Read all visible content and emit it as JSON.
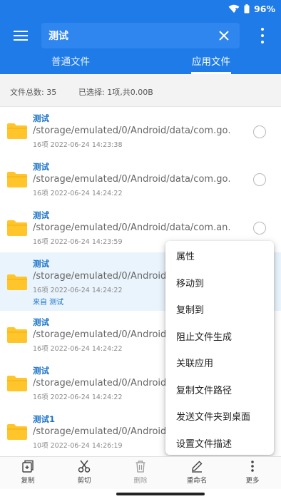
{
  "status": {
    "battery": "96%"
  },
  "search": {
    "query": "测试"
  },
  "tabs": [
    {
      "label": "普通文件",
      "active": false
    },
    {
      "label": "应用文件",
      "active": true
    }
  ],
  "summary": {
    "total": "文件总数: 35",
    "selected": "已选择: 1项,共0.00B"
  },
  "files": [
    {
      "name": "测试",
      "path": "/storage/emulated/0/Android/data/com.go…",
      "meta": "16项  2022-06-24 14:23:38",
      "from": "",
      "selected": false
    },
    {
      "name": "测试",
      "path": "/storage/emulated/0/Android/data/com.go…",
      "meta": "16项  2022-06-24 14:24:22",
      "from": "",
      "selected": false
    },
    {
      "name": "测试",
      "path": "/storage/emulated/0/Android/data/com.an…",
      "meta": "16项  2022-06-24 14:23:59",
      "from": "",
      "selected": false
    },
    {
      "name": "测试",
      "path": "/storage/emulated/0/Android/d",
      "meta": "16项  2022-06-24 14:24:22",
      "from": "来自 测试",
      "selected": true
    },
    {
      "name": "测试",
      "path": "/storage/emulated/0/Android/d",
      "meta": "16项  2022-06-24 14:24:22",
      "from": "",
      "selected": false
    },
    {
      "name": "测试",
      "path": "/storage/emulated/0/Android/d",
      "meta": "16项  2022-06-24 14:24:22",
      "from": "",
      "selected": false
    },
    {
      "name": "测试1",
      "path": "/storage/emulated/0/Android/d",
      "meta": "10项  2022-06-24 14:26:19",
      "from": "",
      "selected": false
    }
  ],
  "context_menu": [
    "属性",
    "移动到",
    "复制到",
    "阻止文件生成",
    "关联应用",
    "复制文件路径",
    "发送文件夹到桌面",
    "设置文件描述"
  ],
  "bottom_actions": [
    {
      "label": "复制",
      "icon": "copy-icon",
      "enabled": true
    },
    {
      "label": "剪切",
      "icon": "scissors-icon",
      "enabled": true
    },
    {
      "label": "删除",
      "icon": "trash-icon",
      "enabled": false
    },
    {
      "label": "重命名",
      "icon": "pencil-icon",
      "enabled": true
    },
    {
      "label": "更多",
      "icon": "more-vertical-icon",
      "enabled": true
    }
  ],
  "colors": {
    "primary": "#1f7be8",
    "folder": "#ffc52a",
    "link": "#1a73c8",
    "selected_row": "#eaf4fc"
  }
}
